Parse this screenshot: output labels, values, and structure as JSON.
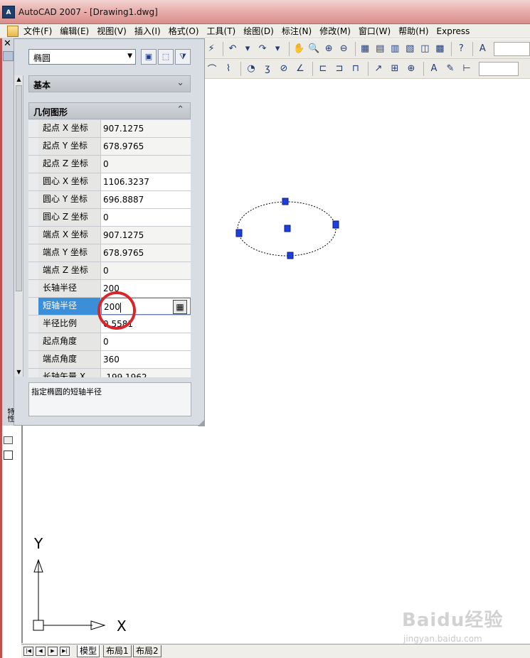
{
  "window": {
    "title": "AutoCAD 2007 - [Drawing1.dwg]"
  },
  "menu": [
    "文件(F)",
    "编辑(E)",
    "视图(V)",
    "插入(I)",
    "格式(O)",
    "工具(T)",
    "绘图(D)",
    "标注(N)",
    "修改(M)",
    "窗口(W)",
    "帮助(H)",
    "Express"
  ],
  "palette": {
    "object_type": "椭圆",
    "categories": {
      "basic": "基本",
      "geometry": "几何图形"
    },
    "properties": [
      {
        "name": "起点 X 坐标",
        "value": "907.1275"
      },
      {
        "name": "起点 Y 坐标",
        "value": "678.9765"
      },
      {
        "name": "起点 Z 坐标",
        "value": "0"
      },
      {
        "name": "圆心 X 坐标",
        "value": "1106.3237"
      },
      {
        "name": "圆心 Y 坐标",
        "value": "696.8887"
      },
      {
        "name": "圆心 Z 坐标",
        "value": "0"
      },
      {
        "name": "端点 X 坐标",
        "value": "907.1275"
      },
      {
        "name": "端点 Y 坐标",
        "value": "678.9765"
      },
      {
        "name": "端点 Z 坐标",
        "value": "0"
      },
      {
        "name": "长轴半径",
        "value": "200"
      },
      {
        "name": "短轴半径",
        "value": "200"
      },
      {
        "name": "半径比例",
        "value": "0.5581"
      },
      {
        "name": "起点角度",
        "value": "0"
      },
      {
        "name": "端点角度",
        "value": "360"
      },
      {
        "name": "长轴矢量 X",
        "value": "-199.1962"
      }
    ],
    "description": "指定椭圆的短轴半径",
    "side_label": "特性"
  },
  "ucs": {
    "x_label": "X",
    "y_label": "Y"
  },
  "tabs": {
    "model": "模型",
    "layout1": "布局1",
    "layout2": "布局2"
  },
  "watermark": {
    "main": "Baidu经验",
    "url": "jingyan.baidu.com"
  }
}
